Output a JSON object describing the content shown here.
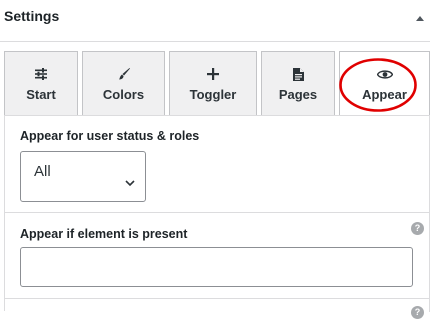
{
  "panel": {
    "title": "Settings"
  },
  "tabs": [
    {
      "label": "Start",
      "icon": "sliders-icon"
    },
    {
      "label": "Colors",
      "icon": "paintbrush-icon"
    },
    {
      "label": "Toggler",
      "icon": "plus-icon"
    },
    {
      "label": "Pages",
      "icon": "page-icon"
    },
    {
      "label": "Appear",
      "icon": "eye-icon",
      "active": true
    }
  ],
  "annotation_color": "#e00000",
  "appear": {
    "roles_label": "Appear for user status & roles",
    "roles_value": "All",
    "element_label": "Appear if element is present",
    "element_value": "",
    "help_symbol": "?"
  }
}
